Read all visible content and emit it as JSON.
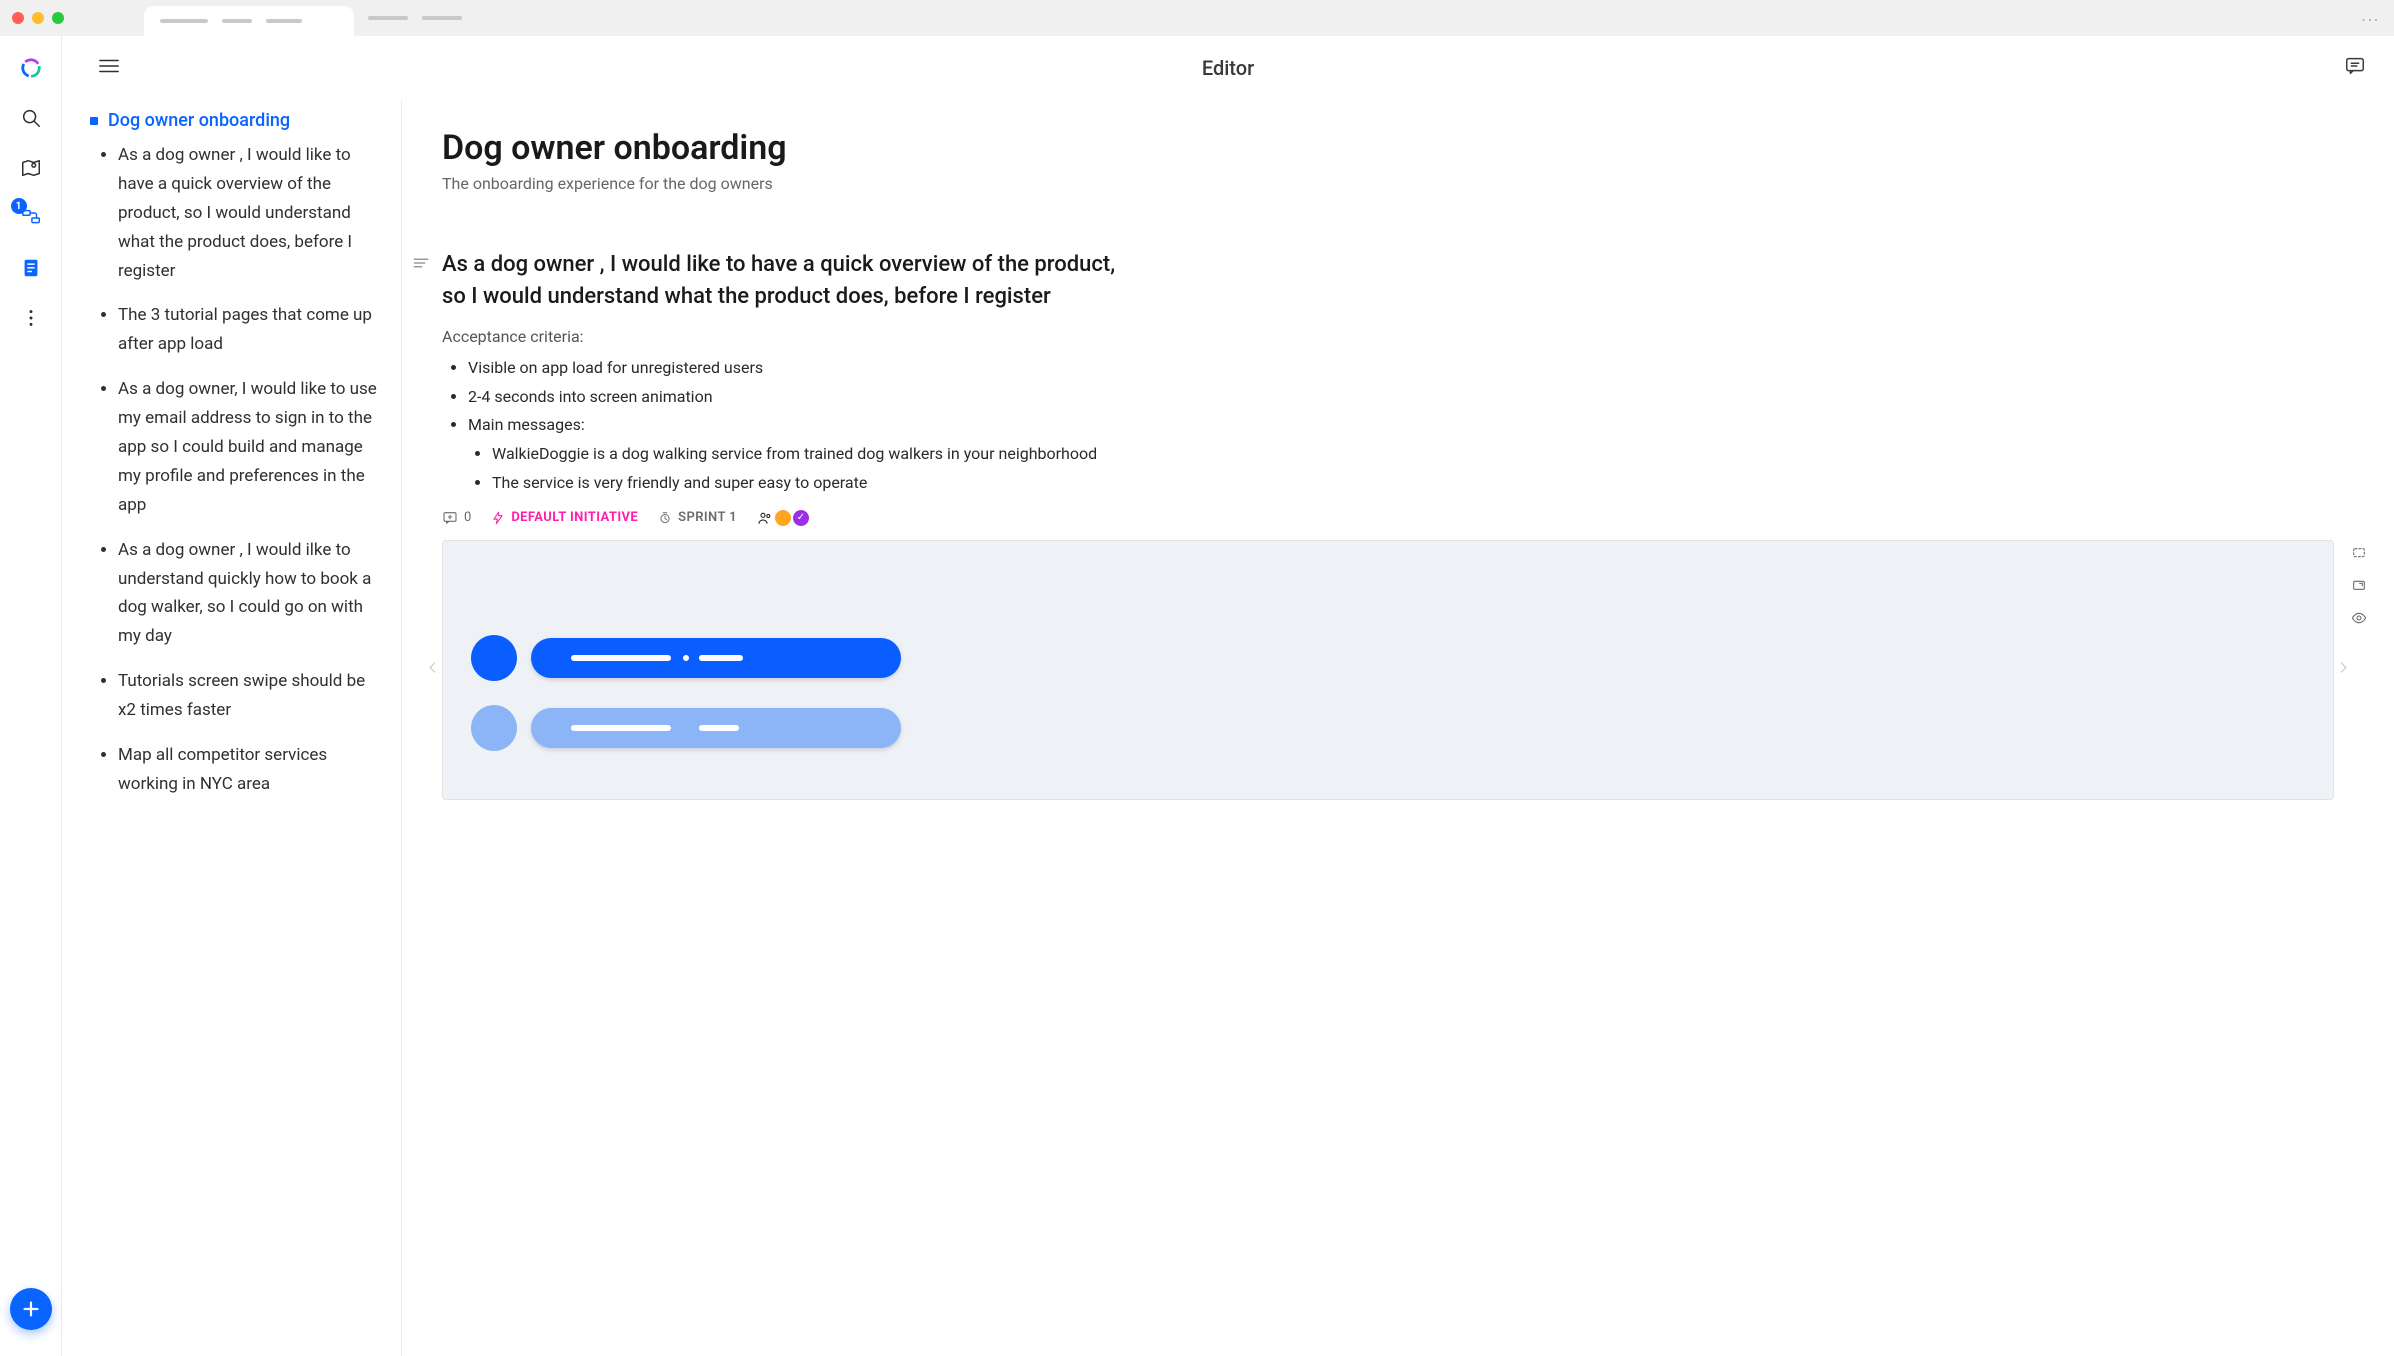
{
  "header": {
    "title": "Editor"
  },
  "rail": {
    "badge_count": "1"
  },
  "outline": {
    "root": "Dog owner onboarding",
    "items": [
      "As a dog owner , I would like to have a quick overview of the product, so I would understand what the product does, before I register",
      "The 3 tutorial pages that come up after app load",
      "As a dog owner, I would like to use my email address to sign in to the app so I could build and manage my profile and preferences in the app",
      "As a dog owner , I would ilke to understand quickly how to book a dog walker, so I could go on with my day",
      "Tutorials screen swipe should be x2 times faster",
      "Map all competitor services working in NYC area"
    ]
  },
  "doc": {
    "title": "Dog owner onboarding",
    "subtitle": "The onboarding experience for the dog owners"
  },
  "story": {
    "title": "As a dog owner , I would like to have a quick overview of the product, so I would understand what the product does, before I register",
    "acceptance_label": "Acceptance criteria:",
    "criteria": [
      "Visible on app load for unregistered users",
      "2-4 seconds into screen animation",
      "Main messages:"
    ],
    "criteria_nested": [
      "WalkieDoggie is a dog walking service from trained dog walkers in your neighborhood",
      "The service is very friendly and super easy to operate"
    ],
    "meta": {
      "comments_count": "0",
      "initiative": "DEFAULT INITIATIVE",
      "sprint": "SPRINT 1"
    }
  }
}
